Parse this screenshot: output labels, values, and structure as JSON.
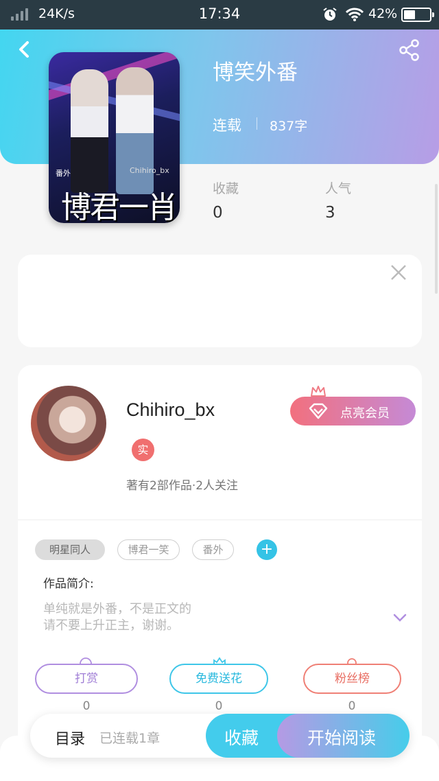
{
  "status_bar": {
    "speed": "24K/s",
    "time": "17:34",
    "battery": "42%"
  },
  "book": {
    "title": "博笑外番",
    "status": "连载",
    "words": "837字",
    "cover": {
      "overlay_small": "番外",
      "watermark": "Chihiro_bx",
      "overlay_big": "博君一肖"
    },
    "stats": [
      {
        "label": "收藏",
        "value": "0"
      },
      {
        "label": "人气",
        "value": "3"
      }
    ]
  },
  "author": {
    "name": "Chihiro_bx",
    "badge": "实",
    "meta": "著有2部作品·2人关注",
    "vip_label": "点亮会员"
  },
  "tags": [
    "明星同人",
    "博君一笑",
    "番外"
  ],
  "intro": {
    "label": "作品简介:",
    "line1": "单纯就是外番，不是正文的",
    "line2": "请不要上升正主，谢谢。"
  },
  "actions": [
    {
      "label": "打赏",
      "count": "0",
      "color": "#b08ee0"
    },
    {
      "label": "免费送花",
      "count": "0",
      "color": "#3ec6e8"
    },
    {
      "label": "粉丝榜",
      "count": "0",
      "color": "#ef7f75"
    }
  ],
  "bottom_bar": {
    "toc_label": "目录",
    "toc_sub": "已连载1章",
    "favorite_label": "收藏",
    "read_label": "开始阅读"
  }
}
